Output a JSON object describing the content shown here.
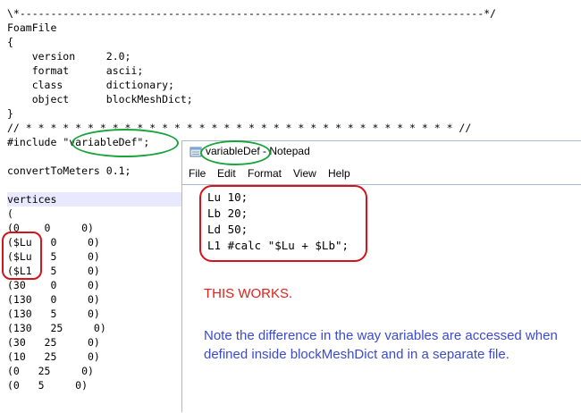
{
  "editor": {
    "lines": [
      {
        "text": "\\*---------------------------------------------------------------------------*/"
      },
      {
        "text": "FoamFile"
      },
      {
        "text": "{"
      },
      {
        "text": "    version     2.0;"
      },
      {
        "text": "    format      ascii;"
      },
      {
        "text": "    class       dictionary;"
      },
      {
        "text": "    object      blockMeshDict;"
      },
      {
        "text": "}"
      },
      {
        "text": "// * * * * * * * * * * * * * * * * * * * * * * * * * * * * * * * * * * * //"
      },
      {
        "pre": "#include ",
        "str": "\"variableDef\"",
        "post": ";"
      },
      {
        "text": ""
      },
      {
        "text": "convertToMeters 0.1;"
      },
      {
        "text": ""
      },
      {
        "text": "vertices"
      },
      {
        "text": "("
      },
      {
        "text": "(0    0     0)"
      },
      {
        "text": "($Lu   0     0)"
      },
      {
        "text": "($Lu   5     0)"
      },
      {
        "text": "($L1   5     0)"
      },
      {
        "text": "(30    0     0)"
      },
      {
        "text": "(130   0     0)"
      },
      {
        "text": "(130   5     0)"
      },
      {
        "text": "(130   25     0)"
      },
      {
        "text": "(30   25     0)"
      },
      {
        "text": "(10   25     0)"
      },
      {
        "text": "(0   25     0)"
      },
      {
        "text": "(0   5     0)"
      }
    ]
  },
  "notepad": {
    "title_file": "variableDef",
    "title_app": " - Notepad",
    "menu": [
      "File",
      "Edit",
      "Format",
      "View",
      "Help"
    ],
    "code": [
      "Lu 10;",
      "Lb 20;",
      "Ld 50;",
      "L1 #calc \"$Lu + $Lb\";"
    ],
    "note_red": "THIS WORKS.",
    "note_blue": "Note the difference in the way variables are accessed when defined inside blockMeshDict and in a separate file."
  },
  "colors": {
    "ring_green": "#19a33b",
    "box_red": "#d1151c",
    "note_red": "#e0201c",
    "note_blue": "#3b4bd0",
    "selection": "#e8e8ff"
  }
}
